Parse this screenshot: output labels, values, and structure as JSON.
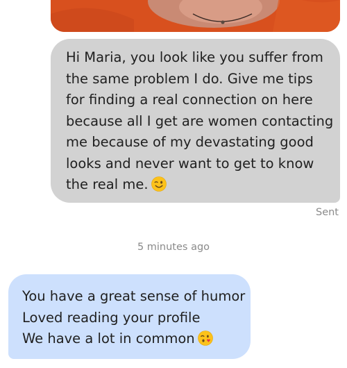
{
  "sent_message": {
    "lines": [
      "Hi Maria, you look like you suffer from",
      "the same problem I do. Give me tips",
      "for finding a real connection on here",
      "because all I get are women contacting",
      "me because of my devastating good",
      "looks and never want to get to know",
      "the real me."
    ],
    "emoji": "winking-face",
    "status": "Sent"
  },
  "timestamp": "5 minutes ago",
  "received_message": {
    "lines": [
      "You have a great sense of humor",
      "Loved reading your profile",
      "We have a lot in common"
    ],
    "emoji": "face-blowing-kiss"
  },
  "colors": {
    "sent_bubble": "#d2d2d2",
    "received_bubble": "#cde0fd",
    "meta_text": "#8a8a8a",
    "photo_background": "#d8501e"
  }
}
